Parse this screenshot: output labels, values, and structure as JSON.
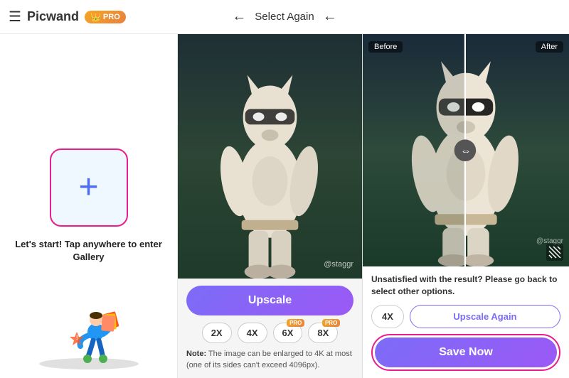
{
  "header": {
    "brand": "Picwand",
    "pro_label": "PRO",
    "select_again": "Select Again",
    "crown": "👑"
  },
  "left_panel": {
    "upload_text": "Let's start! Tap anywhere to enter Gallery",
    "plus_icon": "+"
  },
  "center_panel": {
    "watermark": "@staggr",
    "upscale_btn": "Upscale",
    "scale_options": [
      {
        "label": "2X",
        "is_pro": false,
        "active": false
      },
      {
        "label": "4X",
        "is_pro": false,
        "active": false
      },
      {
        "label": "6X",
        "is_pro": true,
        "active": false
      },
      {
        "label": "8X",
        "is_pro": true,
        "active": false
      }
    ],
    "note": "Note:",
    "note_text": " The image can be enlarged to 4K at most (one of its sides can't exceed 4096px)."
  },
  "right_panel": {
    "before_label": "Before",
    "after_label": "After",
    "watermark": "@staggr",
    "unsatisfied_text": "Unsatisfied with the result? Please go back to select other options.",
    "scale_4x": "4X",
    "upscale_again": "Upscale Again",
    "save_now": "Save Now"
  }
}
